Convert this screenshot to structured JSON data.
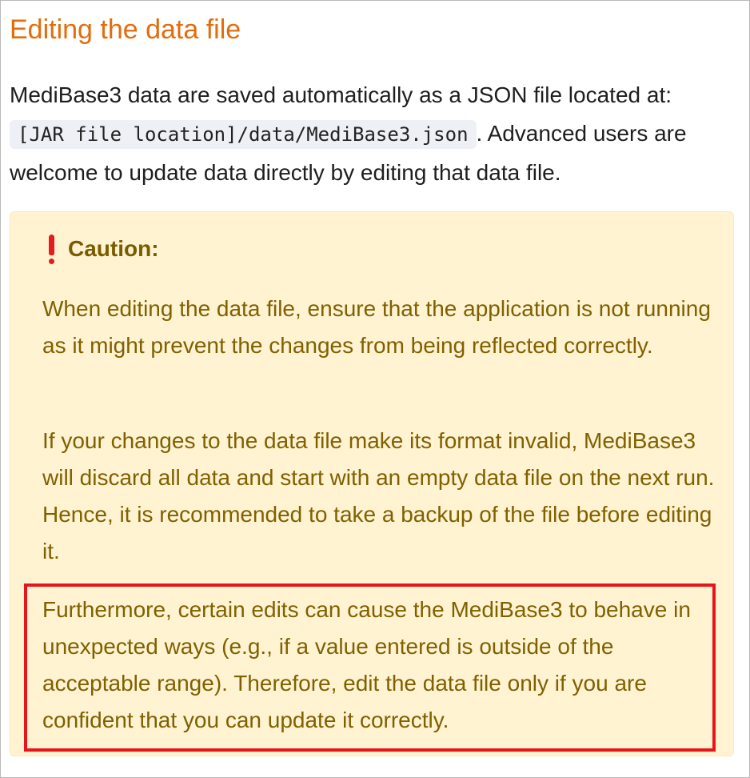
{
  "page": {
    "title": "Editing the data file"
  },
  "intro": {
    "text_before": "MediBase3 data are saved automatically as a JSON file located at:",
    "code_path": "[JAR file location]/data/MediBase3.json",
    "text_after": ". Advanced users are welcome to update data directly by editing that data file."
  },
  "caution": {
    "icon": "exclamation-icon",
    "title": "Caution:",
    "paragraphs": [
      "When editing the data file, ensure that the application is not running as it might prevent the changes from being reflected correctly.",
      "If your changes to the data file make its format invalid, MediBase3 will discard all data and start with an empty data file on the next run. Hence, it is recommended to take a backup of the file before editing it.",
      "Furthermore, certain edits can cause the MediBase3 to behave in unexpected ways (e.g., if a value entered is outside of the acceptable range). Therefore, edit the data file only if you are confident that you can update it correctly."
    ]
  },
  "colors": {
    "title": "#e46c0a",
    "callout_background": "#fff3d2",
    "callout_text": "#806000",
    "icon": "#e31b23",
    "highlight_border": "#e8141b"
  }
}
